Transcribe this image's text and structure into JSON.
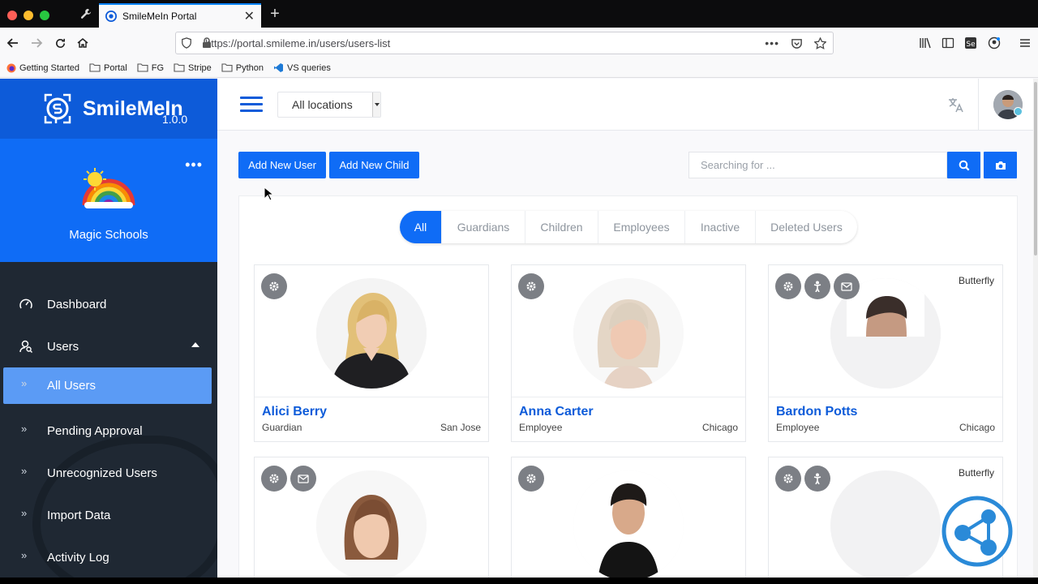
{
  "browser": {
    "tab_title": "SmileMeIn Portal",
    "url": "https://portal.smileme.in/users/users-list",
    "bookmarks": [
      "Getting Started",
      "Portal",
      "FG",
      "Stripe",
      "Python",
      "VS queries"
    ]
  },
  "sidebar": {
    "brand": "SmileMeIn",
    "version": "1.0.0",
    "school_name": "Magic Schools",
    "more_label": "•••",
    "items": [
      {
        "label": "Dashboard"
      },
      {
        "label": "Users"
      }
    ],
    "subitems": [
      {
        "label": "All Users"
      },
      {
        "label": "Pending Approval"
      },
      {
        "label": "Unrecognized Users"
      },
      {
        "label": "Import Data"
      },
      {
        "label": "Activity Log"
      }
    ]
  },
  "header": {
    "location_selected": "All locations"
  },
  "toolbar": {
    "add_user": "Add New User",
    "add_child": "Add New Child",
    "search_placeholder": "Searching for ..."
  },
  "filters": [
    {
      "label": "All"
    },
    {
      "label": "Guardians"
    },
    {
      "label": "Children"
    },
    {
      "label": "Employees"
    },
    {
      "label": "Inactive"
    },
    {
      "label": "Deleted Users"
    }
  ],
  "cards": [
    {
      "name": "Alici Berry",
      "role": "Guardian",
      "city": "San Jose",
      "group": ""
    },
    {
      "name": "Anna Carter",
      "role": "Employee",
      "city": "Chicago",
      "group": ""
    },
    {
      "name": "Bardon Potts",
      "role": "Employee",
      "city": "Chicago",
      "group": "Butterfly"
    },
    {
      "name": "",
      "role": "",
      "city": "",
      "group": ""
    },
    {
      "name": "",
      "role": "",
      "city": "",
      "group": ""
    },
    {
      "name": "",
      "role": "",
      "city": "",
      "group": "Butterfly"
    }
  ],
  "colors": {
    "brand_blue": "#0f6cf6",
    "brand_dark_blue": "#0d5bd9",
    "sidebar_bg": "#1f2833",
    "active_item": "#5b9bf5"
  }
}
